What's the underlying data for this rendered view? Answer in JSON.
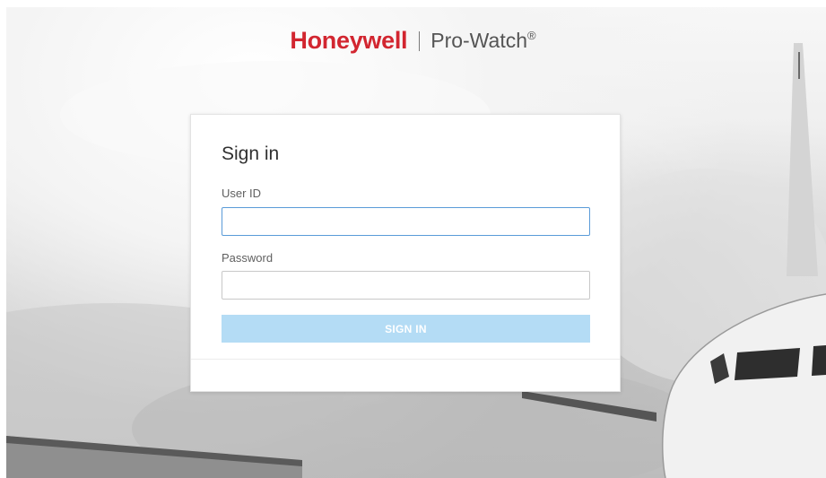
{
  "brand": {
    "logo_text": "Honeywell",
    "product_name": "Pro-Watch",
    "product_mark": "®",
    "logo_color": "#d22630"
  },
  "signin": {
    "title": "Sign in",
    "user_id_label": "User ID",
    "user_id_value": "",
    "password_label": "Password",
    "password_value": "",
    "button_label": "SIGN IN",
    "button_color": "#b4dcf5",
    "focus_color": "#5a9bd8"
  },
  "background": {
    "subject": "airplane-photo",
    "tone": "grayscale"
  }
}
